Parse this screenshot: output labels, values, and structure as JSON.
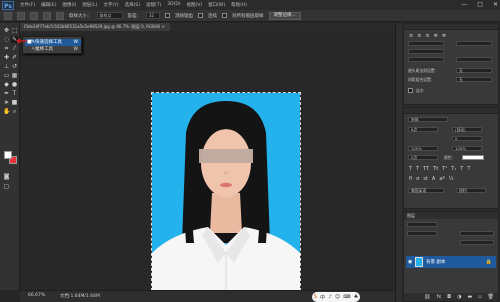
{
  "app": {
    "logo": "Ps"
  },
  "menus": [
    "文件(F)",
    "编辑(E)",
    "图像(I)",
    "图层(L)",
    "文字(Y)",
    "选择(S)",
    "滤镜(T)",
    "3D(D)",
    "视图(V)",
    "窗口(W)",
    "帮助(H)"
  ],
  "window_controls": {
    "minimize": "—",
    "maximize": "□",
    "close": "✕"
  },
  "options_bar": {
    "sample_size_label": "取样大小：",
    "sample_size_value": "取样点",
    "tolerance_label": "容差：",
    "tolerance_value": "32",
    "antialias_label": "消除锯齿",
    "contiguous_label": "连续",
    "all_layers_label": "对所有图层取样",
    "refine_button": "调整边缘..."
  },
  "document_tab": {
    "title": "f3de34f77eb7c502b06531a5e5e98529.jpg @ 66.7% (图层 0, RGB/8) ×"
  },
  "flyout": {
    "items": [
      {
        "label": "快速选择工具",
        "shortcut": "W",
        "active": true,
        "icon": "quick-selection-icon"
      },
      {
        "label": "魔棒工具",
        "shortcut": "W",
        "active": false,
        "icon": "magic-wand-icon"
      }
    ]
  },
  "status": {
    "zoom": "66.67%",
    "doc_size": "文档:1.64M/1.64M"
  },
  "watermark_icons": [
    "S",
    "中",
    "♪",
    "☺",
    "⌨",
    "♣"
  ],
  "right_panel": {
    "character_font": "宋体",
    "size": "6点",
    "leading": "(自动)",
    "tracking": "0",
    "vertical_scale": "100%",
    "horizontal_scale": "100%",
    "baseline": "0点",
    "color_label": "颜色：",
    "paragraph_label": "避头尾法则设置：",
    "paragraph_value": "无",
    "composer_label": "间距组合设置：",
    "composer_value": "无",
    "hyphenate_label": "连字",
    "lang": "美国英语",
    "aa": "锐利"
  },
  "layers_panel": {
    "tab_label": "图层",
    "layer_name": "背景 副本"
  }
}
